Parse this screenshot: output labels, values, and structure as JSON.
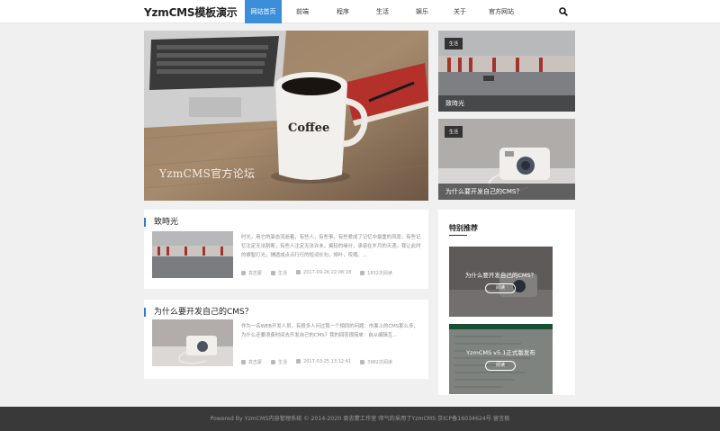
{
  "header": {
    "logo": "YzmCMS模板演示",
    "nav": [
      {
        "label": "网站首页",
        "active": true
      },
      {
        "label": "前端",
        "active": false
      },
      {
        "label": "程序",
        "active": false
      },
      {
        "label": "生活",
        "active": false
      },
      {
        "label": "娱乐",
        "active": false
      },
      {
        "label": "关于",
        "active": false
      },
      {
        "label": "官方网站",
        "active": false
      }
    ],
    "search_icon": "search-icon"
  },
  "slider": {
    "caption": "YzmCMS官方论坛",
    "mug_text": "Coffee",
    "dots": [
      {
        "active": false
      },
      {
        "active": true
      }
    ]
  },
  "side_cards": [
    {
      "tag": "生活",
      "title": "致時光"
    },
    {
      "tag": "生活",
      "title": "为什么要开发自己的CMS？"
    }
  ],
  "articles": [
    {
      "title": "致時光",
      "excerpt": "时光，用它的姿态流逝着，有些人，有些事，有些爱成了记忆中最重的风景，有些记忆注定无法割断，有些人注定无法许未，冀轻的缘分，承诺在岁月的天涯。我让此时的睿智灯光，辅透成点点行行的短词长句，倾叶，哎哦。...",
      "author": "袁志蒙",
      "category": "生活",
      "date": "2017-09-26 22:08:18",
      "views": "1832次阅读"
    },
    {
      "title": "为什么要开发自己的CMS？",
      "excerpt": "作为一名WEB开发人员，有很多人问过我一个相同的问题：市面上的CMS那么多，为什么还要浪费时间去开发自己的CMS？我的回答很简单：自从编辑互...",
      "author": "袁志蒙",
      "category": "生活",
      "date": "2017-03-25 13:12:41",
      "views": "3982次阅读"
    }
  ],
  "recommend": {
    "title": "特别推荐",
    "items": [
      {
        "title": "为什么要开发自己的CMS？",
        "button": "阅读"
      },
      {
        "title": "YzmCMS v5.1正式版发布",
        "button": "阅读"
      }
    ]
  },
  "footer": {
    "text": "Powered By YzmCMS内容管理系统 © 2014-2020 袁志蒙工作室 帅气的采用了YzmCMS 京ICP备16034624号 留言板"
  },
  "colors": {
    "accent": "#3a8fd8",
    "footer_bg": "#393939",
    "title_bar": "#2a7bd1"
  }
}
